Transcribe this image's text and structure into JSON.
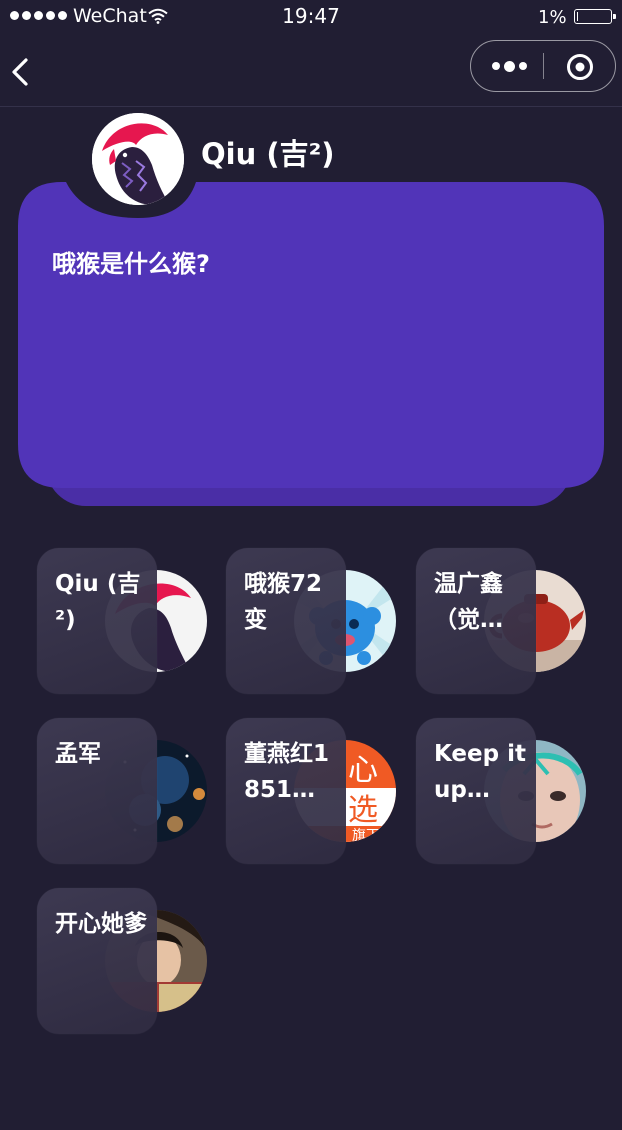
{
  "status_bar": {
    "carrier": "WeChat",
    "time": "19:47",
    "battery_percent": "1%",
    "battery_level": 0.01
  },
  "nav": {
    "back_icon": "chevron-left-icon",
    "more_icon": "more-dots-icon",
    "close_icon": "target-close-icon"
  },
  "author": {
    "name": "Qiu (吉²)",
    "avatar_icon": "rooster-avatar"
  },
  "question": {
    "text": "哦猴是什么猴?"
  },
  "colors": {
    "background": "#211e33",
    "card": "#5134b8",
    "card_shadow": "#4a2ea6"
  },
  "users": [
    {
      "name": "Qiu (吉²)",
      "avatar": "rooster-avatar"
    },
    {
      "name": "哦猴72变",
      "avatar": "blue-monkey-avatar"
    },
    {
      "name": "温广鑫（觉…",
      "avatar": "red-teapot-avatar"
    },
    {
      "name": "孟军",
      "avatar": "space-planets-avatar"
    },
    {
      "name": "董燕红1851…",
      "avatar": "orange-shop-avatar"
    },
    {
      "name": "Keep it up…",
      "avatar": "face-art-avatar"
    },
    {
      "name": "开心她爹",
      "avatar": "child-photo-avatar"
    }
  ],
  "shop_avatar_text": {
    "line1": "心",
    "line2": "选",
    "line3": "旗下"
  }
}
